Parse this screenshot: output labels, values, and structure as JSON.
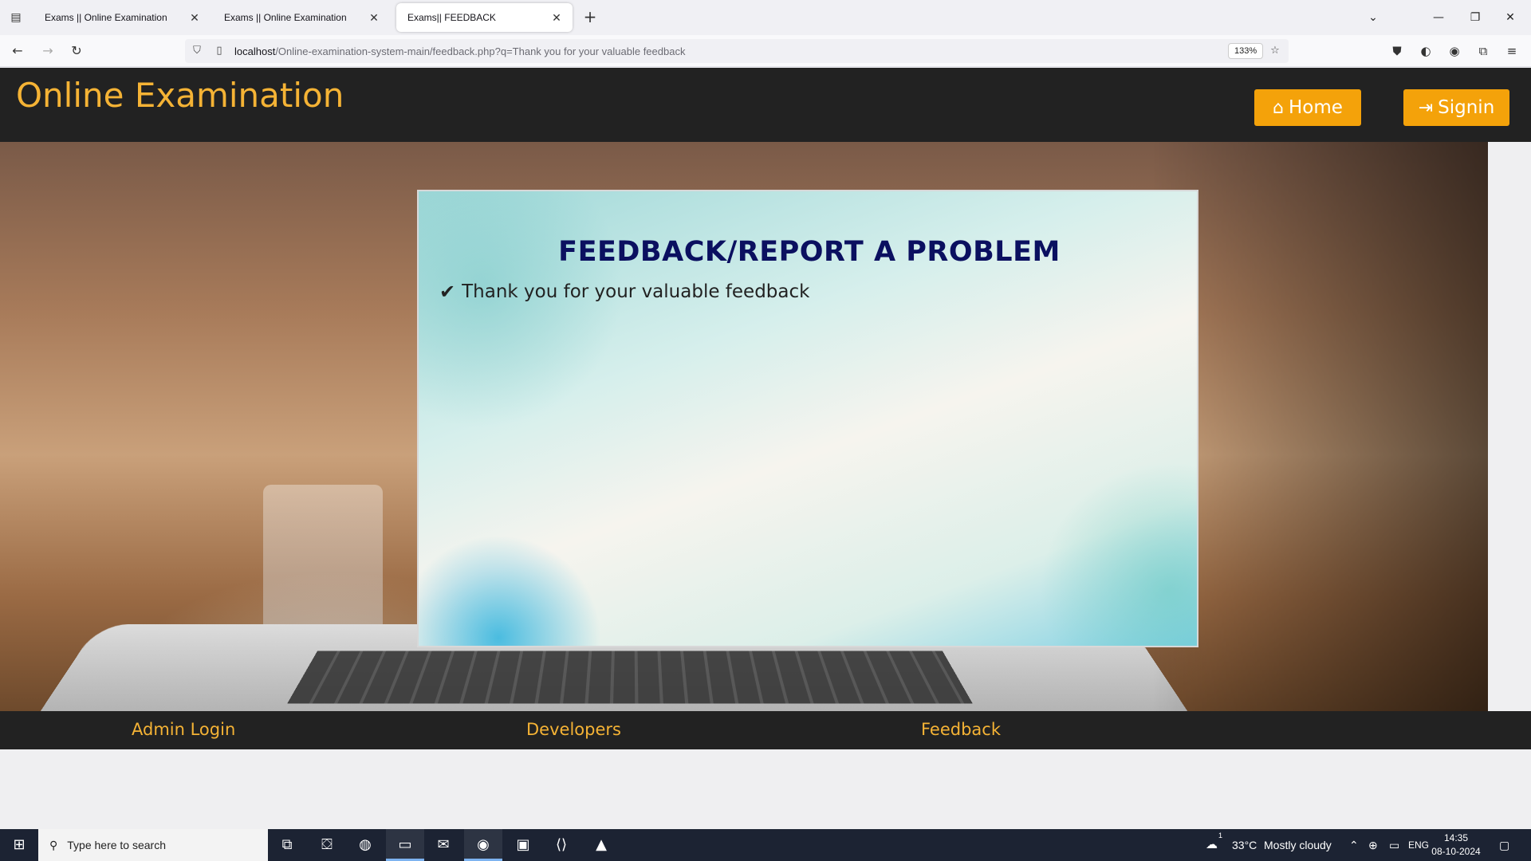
{
  "browser": {
    "tabs": [
      {
        "title": "Exams || Online Examination"
      },
      {
        "title": "Exams || Online Examination"
      },
      {
        "title": "Exams|| FEEDBACK"
      }
    ],
    "url_host": "localhost",
    "url_path": "/Online-examination-system-main/feedback.php?q=Thank you for your valuable feedback",
    "zoom": "133%"
  },
  "site": {
    "title": "Online Examination",
    "nav": {
      "home_label": "Home",
      "signin_label": "Signin"
    }
  },
  "feedback": {
    "heading": "FEEDBACK/REPORT A PROBLEM",
    "message": "Thank you for your valuable feedback"
  },
  "footer": {
    "links": [
      "Admin Login",
      "Developers",
      "Feedback"
    ]
  },
  "taskbar": {
    "search_placeholder": "Type here to search",
    "weather_temp": "33°C",
    "weather_text": "Mostly cloudy",
    "lang": "ENG",
    "time": "14:35",
    "date": "08-10-2024",
    "weather_badge": "1"
  },
  "colors": {
    "header_bg": "#222222",
    "brand_yellow": "#f5b335",
    "button_orange": "#f4a20a",
    "heading_navy": "#0b1060"
  }
}
